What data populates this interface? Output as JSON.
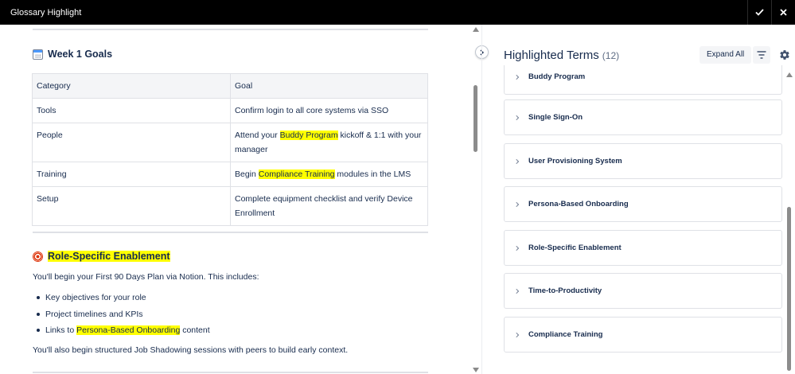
{
  "window": {
    "title": "Glossary Highlight"
  },
  "document": {
    "goals_heading": "Week 1 Goals",
    "table": {
      "headers": [
        "Category",
        "Goal"
      ],
      "rows": [
        {
          "category": "Tools",
          "pre": "Confirm login to all core systems via SSO",
          "term": "",
          "post": ""
        },
        {
          "category": "People",
          "pre": "Attend your ",
          "term": "Buddy Program",
          "post": " kickoff & 1:1 with your manager"
        },
        {
          "category": "Training",
          "pre": "Begin ",
          "term": "Compliance Training",
          "post": " modules in the LMS"
        },
        {
          "category": "Setup",
          "pre": "Complete equipment checklist and verify Device Enrollment",
          "term": "",
          "post": ""
        }
      ]
    },
    "role_heading": "Role-Specific Enablement",
    "role_intro": "You'll begin your First 90 Days Plan via Notion. This includes:",
    "bullets": [
      {
        "pre": "Key objectives for your role",
        "term": "",
        "post": ""
      },
      {
        "pre": "Project timelines and KPIs",
        "term": "",
        "post": ""
      },
      {
        "pre": "Links to ",
        "term": "Persona-Based Onboarding",
        "post": " content"
      }
    ],
    "closing": "You'll also begin structured Job Shadowing sessions with peers to build early context."
  },
  "panel": {
    "title": "Highlighted Terms",
    "count": "(12)",
    "expand_all_label": "Expand All",
    "terms": [
      "Buddy Program",
      "Single Sign-On",
      "User Provisioning System",
      "Persona-Based Onboarding",
      "Role-Specific Enablement",
      "Time-to-Productivity",
      "Compliance Training"
    ]
  },
  "colors": {
    "highlight": "#ffff00",
    "titlebar": "#000000",
    "text": "#172b4d"
  },
  "icons": [
    "calendar-icon",
    "target-icon",
    "check-icon",
    "close-icon",
    "chevron-right-icon",
    "filter-icon",
    "gear-icon"
  ]
}
